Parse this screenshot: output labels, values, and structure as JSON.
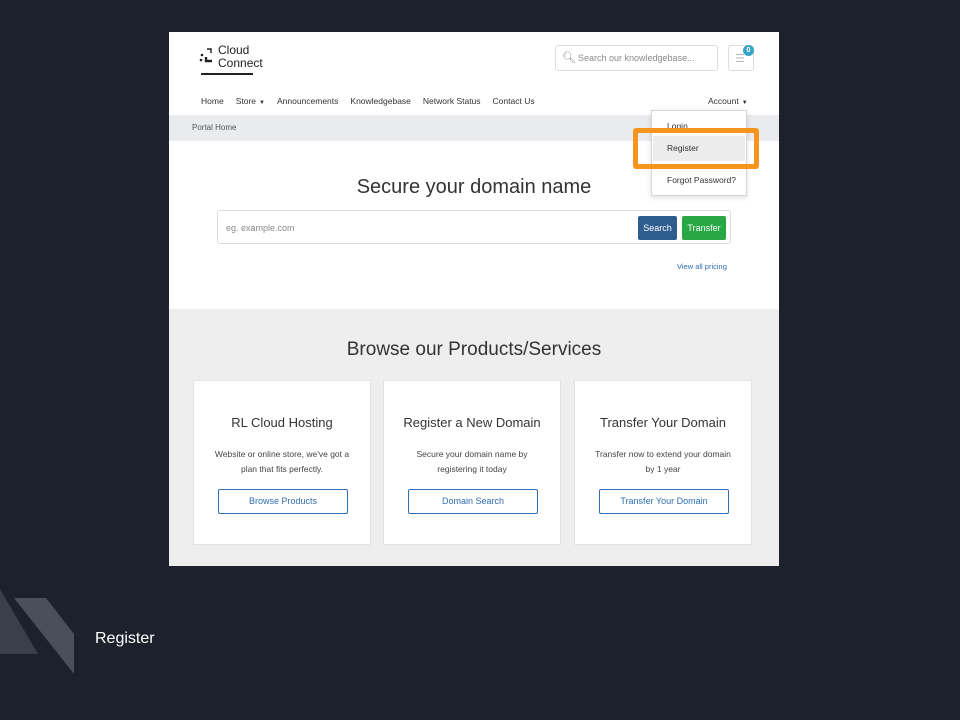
{
  "brand": {
    "logo_text": "Cloud\nConnect"
  },
  "header": {
    "search_placeholder": "Search our knowledgebase...",
    "cart_count": "0"
  },
  "nav": {
    "items": [
      "Home",
      "Store",
      "Announcements",
      "Knowledgebase",
      "Network Status",
      "Contact Us"
    ],
    "account": "Account"
  },
  "breadcrumb": "Portal Home",
  "account_menu": {
    "login": "Login",
    "register": "Register",
    "forgot": "Forgot Password?"
  },
  "hero": {
    "title": "Secure your domain name",
    "placeholder": "eg. example.com",
    "search_button": "Search",
    "transfer_button": "Transfer",
    "pricing_link": "View all pricing"
  },
  "products": {
    "title": "Browse our Products/Services",
    "cards": [
      {
        "title": "RL Cloud Hosting",
        "text": "Website or online store, we've got a plan that fits perfectly.",
        "button": "Browse Products"
      },
      {
        "title": "Register a New Domain",
        "text": "Secure your domain name by registering it today",
        "button": "Domain Search"
      },
      {
        "title": "Transfer Your Domain",
        "text": "Transfer now to extend your domain by 1 year",
        "button": "Transfer Your Domain"
      }
    ]
  },
  "caption": "Register",
  "colors": {
    "slide_background": "#1d212b",
    "highlight": "#f7941d",
    "search_button": "#2f5c8f",
    "transfer_button": "#28a745",
    "link": "#2f6eb3"
  }
}
